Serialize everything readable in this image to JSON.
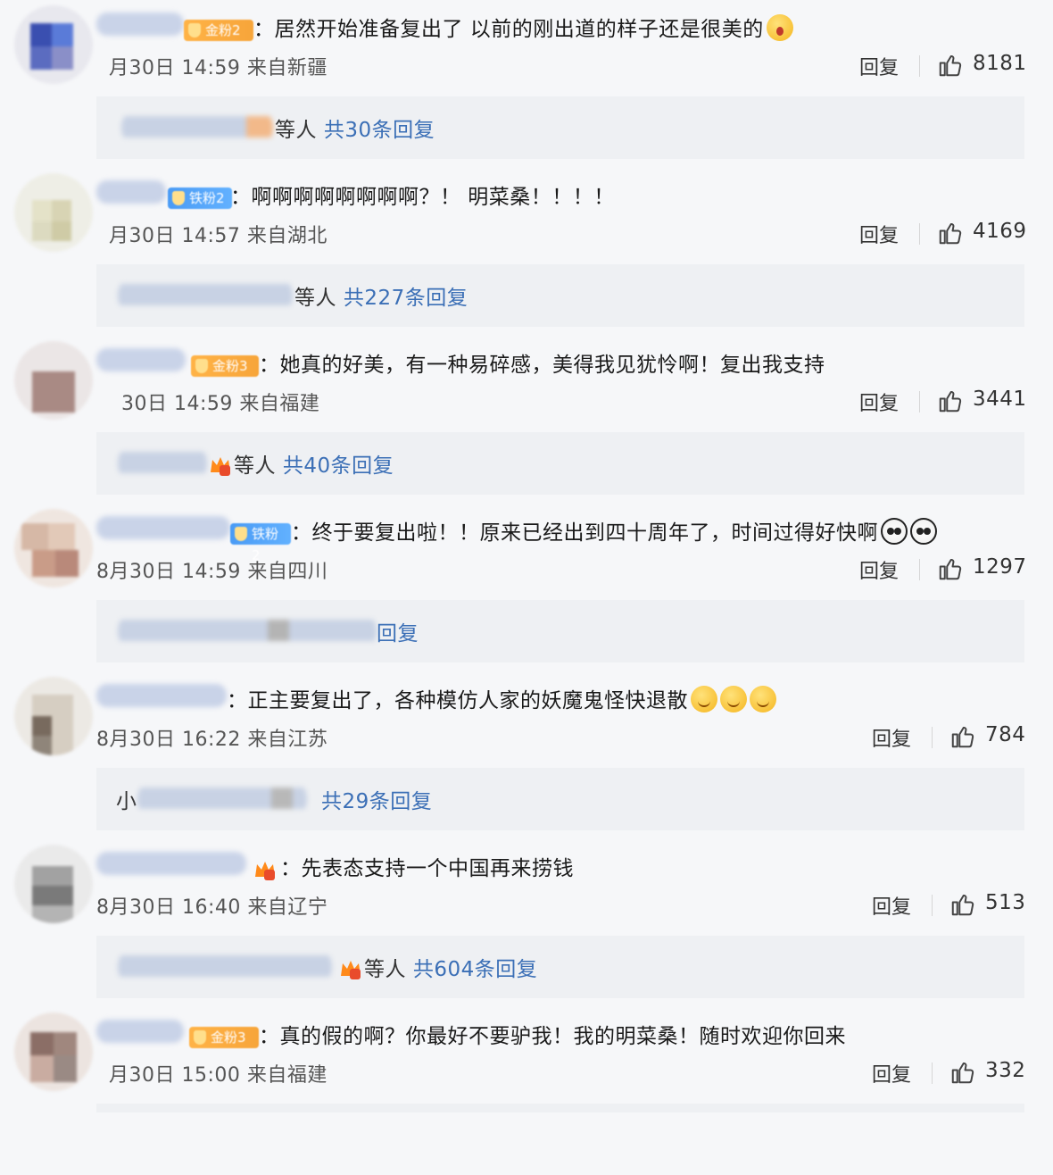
{
  "colors": {
    "link": "#3b6fb6",
    "badge_gold": "#f7a53a",
    "badge_iron": "#4a9bf5",
    "background": "#f6f7f9",
    "reply_box": "#eef0f3"
  },
  "icons": {
    "like": "thumbs-up-icon",
    "fan": "fan-crown-icon"
  },
  "reply_label": "回复",
  "comments": [
    {
      "badge": "金粉2",
      "text": "居然开始准备复出了 以前的刚出道的样子还是很美的",
      "meta": "月30日 14:59 来自新疆",
      "likes": "8181",
      "replies": {
        "prefix": "",
        "suffix": "等人",
        "link": "共30条回复"
      }
    },
    {
      "badge": "铁粉2",
      "text": "啊啊啊啊啊啊啊啊？！ 明菜桑！！！！",
      "meta": "月30日 14:57 来自湖北",
      "likes": "4169",
      "replies": {
        "prefix": "",
        "suffix": "等人",
        "link": "共227条回复"
      }
    },
    {
      "badge": "金粉3",
      "text": "她真的好美，有一种易碎感，美得我见犹怜啊！复出我支持",
      "meta": "30日 14:59 来自福建",
      "likes": "3441",
      "replies": {
        "prefix": "",
        "suffix": "等人",
        "link": "共40条回复"
      }
    },
    {
      "badge": "铁粉2",
      "text": "终于要复出啦！！原来已经出到四十周年了，时间过得好快啊",
      "meta": "8月30日 14:59 来自四川",
      "likes": "1297",
      "replies": {
        "prefix": "",
        "suffix": "",
        "link": "回复"
      }
    },
    {
      "badge": "",
      "text": "正主要复出了，各种模仿人家的妖魔鬼怪快退散",
      "meta": "8月30日 16:22 来自江苏",
      "likes": "784",
      "replies": {
        "prefix": "小",
        "suffix": "",
        "link": "共29条回复"
      }
    },
    {
      "badge": "",
      "text": "先表态支持一个中国再来捞钱",
      "meta": "8月30日 16:40 来自辽宁",
      "likes": "513",
      "replies": {
        "prefix": "",
        "suffix": "等人",
        "link": "共604条回复"
      }
    },
    {
      "badge": "金粉3",
      "text": "真的假的啊？你最好不要驴我！我的明菜桑！随时欢迎你回来",
      "meta": "月30日 15:00 来自福建",
      "likes": "332",
      "replies": null
    }
  ]
}
